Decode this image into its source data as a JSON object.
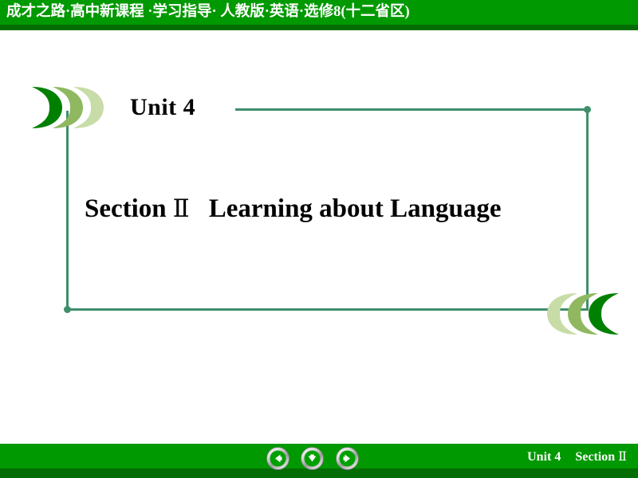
{
  "header": {
    "title": "成才之路·高中新课程 ·学习指导· 人教版·英语·选修8(十二省区)",
    "bar_color": "#019901",
    "shadow_color": "#046d04",
    "text_color": "#ffffff"
  },
  "slide": {
    "unit_label": "Unit 4",
    "section_label": "Section",
    "section_number": "Ⅱ",
    "section_topic": "Learning about Language",
    "frame_color": "#3f8f6b",
    "text_color": "#000000"
  },
  "decorations": {
    "left_chevrons": {
      "name": "left-pointing-crescents",
      "colors": [
        "#008000",
        "#8fb860",
        "#c8dca8"
      ]
    },
    "right_chevrons": {
      "name": "right-pointing-crescents",
      "colors": [
        "#c8dca8",
        "#8fb860",
        "#008000"
      ]
    }
  },
  "footer": {
    "unit_label": "Unit 4",
    "section_label": "Section",
    "section_number": "Ⅱ",
    "bar_color": "#019901",
    "shadow_color": "#046d04",
    "text_color": "#ffffff",
    "nav": {
      "prev": "previous-slide",
      "down": "next-step",
      "next": "next-slide",
      "arrow_color": "#00a000",
      "ring_color": "#c9c9c9"
    }
  }
}
